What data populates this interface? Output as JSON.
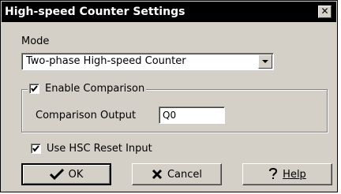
{
  "window": {
    "title": "High-speed Counter Settings",
    "close_glyph": "✕"
  },
  "mode": {
    "label": "Mode",
    "selected": "Two-phase High-speed Counter"
  },
  "comparison": {
    "enable_label": "Enable Comparison",
    "enable_checked": true,
    "output_label": "Comparison Output",
    "output_value": "Q0"
  },
  "reset": {
    "label": "Use HSC Reset Input",
    "checked": true
  },
  "buttons": {
    "ok_label": "OK",
    "cancel_label": "Cancel",
    "help_label": "Help",
    "ok_icon": "checkmark-icon",
    "cancel_icon": "x-mark-icon",
    "help_icon": "question-mark-icon"
  }
}
